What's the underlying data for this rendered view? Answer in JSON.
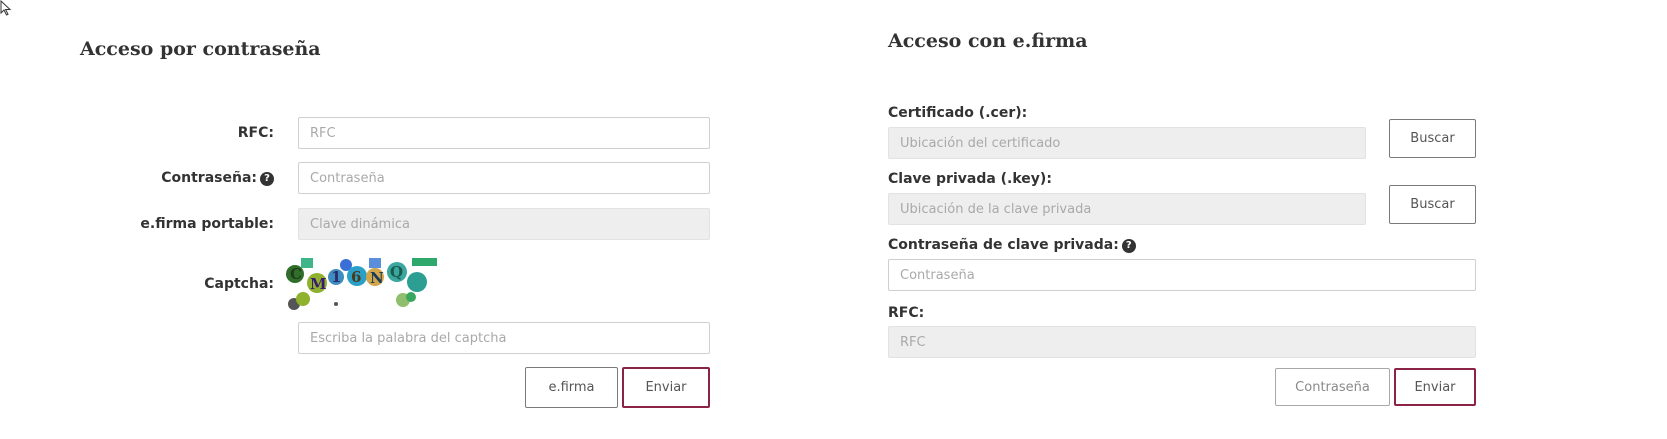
{
  "password_login": {
    "title": "Acceso por contraseña",
    "rfc": {
      "label": "RFC:",
      "placeholder": "RFC"
    },
    "password": {
      "label": "Contraseña:",
      "placeholder": "Contraseña"
    },
    "portable": {
      "label": "e.firma portable:",
      "placeholder": "Clave dinámica"
    },
    "captcha": {
      "label": "Captcha:",
      "placeholder": "Escriba la palabra del captcha",
      "image_text": "CM16NQ"
    },
    "buttons": {
      "efirma": "e.firma",
      "submit": "Enviar"
    }
  },
  "efirma_login": {
    "title": "Acceso con e.firma",
    "certificate": {
      "label": "Certificado (.cer):",
      "placeholder": "Ubicación del certificado",
      "browse": "Buscar"
    },
    "private_key": {
      "label": "Clave privada (.key):",
      "placeholder": "Ubicación de la clave privada",
      "browse": "Buscar"
    },
    "key_password": {
      "label": "Contraseña de clave privada:",
      "placeholder": "Contraseña"
    },
    "rfc": {
      "label": "RFC:",
      "placeholder": "RFC"
    },
    "buttons": {
      "password": "Contraseña",
      "submit": "Enviar"
    }
  },
  "icons": {
    "help": "question-circle-icon",
    "cursor": "mouse-pointer-icon"
  },
  "colors": {
    "accent": "#8b2345",
    "disabled_bg": "#eeeeee",
    "text": "#333333"
  }
}
